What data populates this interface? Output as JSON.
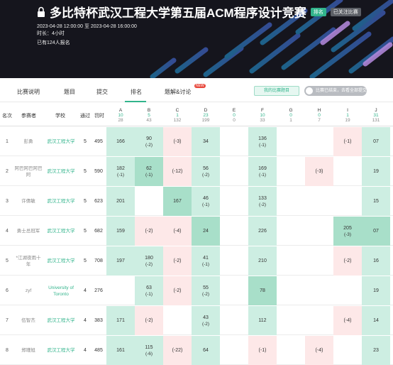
{
  "banner": {
    "title": "多比特杯武汉工程大学第五届ACM程序设计竞赛",
    "badge_status": "排名",
    "badge_follow": "已关注比赛",
    "time_range": "2023-04-28 12:00:00 至 2023-04-28 16:00:00",
    "duration": "时长：4小时",
    "signup": "已有124人报名"
  },
  "tabs": [
    {
      "label": "比赛说明"
    },
    {
      "label": "题目"
    },
    {
      "label": "提交"
    },
    {
      "label": "排名"
    },
    {
      "label": "题解&讨论"
    }
  ],
  "new_tag": "NEW",
  "my_problems_button": "我的比赛题目",
  "toggle_label": "比赛已结束，去看全部提交",
  "headers": {
    "rank": "名次",
    "user": "参赛者",
    "school": "学校",
    "solved": "通过",
    "penalty": "罚时"
  },
  "problems": [
    {
      "letter": "A",
      "ac": "10",
      "total": "28"
    },
    {
      "letter": "B",
      "ac": "5",
      "total": "43"
    },
    {
      "letter": "C",
      "ac": "1",
      "total": "132"
    },
    {
      "letter": "D",
      "ac": "23",
      "total": "199"
    },
    {
      "letter": "E",
      "ac": "0",
      "total": "0"
    },
    {
      "letter": "F",
      "ac": "10",
      "total": "33"
    },
    {
      "letter": "G",
      "ac": "0",
      "total": "1"
    },
    {
      "letter": "H",
      "ac": "0",
      "total": "7"
    },
    {
      "letter": "I",
      "ac": "1",
      "total": "19"
    },
    {
      "letter": "J",
      "ac": "31",
      "total": "131"
    }
  ],
  "rows": [
    {
      "rank": "1",
      "user": "彭勇",
      "school": "武汉工程大学",
      "solved": "5",
      "penalty": "495",
      "cells": [
        [
          "166",
          "",
          "ac"
        ],
        [
          "90",
          "(-2)",
          "ac"
        ],
        [
          "(-3)",
          "",
          "wa"
        ],
        [
          "34",
          "",
          "ac"
        ],
        [
          "",
          "",
          ""
        ],
        [
          "136",
          "(-1)",
          "ac"
        ],
        [
          "",
          "",
          ""
        ],
        [
          "",
          "",
          ""
        ],
        [
          "(-1)",
          "",
          "wa"
        ],
        [
          "07",
          "",
          "ac"
        ]
      ]
    },
    {
      "rank": "2",
      "user": "阿巴阿巴阿巴阿",
      "school": "武汉工程大学",
      "solved": "5",
      "penalty": "590",
      "cells": [
        [
          "182",
          "(-1)",
          "ac"
        ],
        [
          "62",
          "(-1)",
          "first"
        ],
        [
          "(-12)",
          "",
          "wa"
        ],
        [
          "56",
          "(-2)",
          "ac"
        ],
        [
          "",
          "",
          ""
        ],
        [
          "169",
          "(-1)",
          "ac"
        ],
        [
          "",
          "",
          ""
        ],
        [
          "(-3)",
          "",
          "wa"
        ],
        [
          "",
          "",
          ""
        ],
        [
          "19",
          "",
          "ac"
        ]
      ]
    },
    {
      "rank": "3",
      "user": "许倩敏",
      "school": "武汉工程大学",
      "solved": "5",
      "penalty": "623",
      "cells": [
        [
          "201",
          "",
          "ac"
        ],
        [
          "",
          "",
          ""
        ],
        [
          "167",
          "",
          "first"
        ],
        [
          "46",
          "(-1)",
          "ac"
        ],
        [
          "",
          "",
          ""
        ],
        [
          "133",
          "(-2)",
          "ac"
        ],
        [
          "",
          "",
          ""
        ],
        [
          "",
          "",
          ""
        ],
        [
          "",
          "",
          ""
        ],
        [
          "15",
          "",
          "ac"
        ]
      ]
    },
    {
      "rank": "4",
      "user": "勇士总冠军",
      "school": "武汉工程大学",
      "solved": "5",
      "penalty": "682",
      "cells": [
        [
          "159",
          "",
          "ac"
        ],
        [
          "(-2)",
          "",
          "wa"
        ],
        [
          "(-4)",
          "",
          "wa"
        ],
        [
          "24",
          "",
          "first"
        ],
        [
          "",
          "",
          ""
        ],
        [
          "226",
          "",
          "ac"
        ],
        [
          "",
          "",
          ""
        ],
        [
          "",
          "",
          ""
        ],
        [
          "205",
          "(-3)",
          "first"
        ],
        [
          "07",
          "",
          "first"
        ]
      ]
    },
    {
      "rank": "5",
      "user": "*江湖夜雨十年",
      "school": "武汉工程大学",
      "solved": "5",
      "penalty": "708",
      "cells": [
        [
          "197",
          "",
          "ac"
        ],
        [
          "180",
          "(-2)",
          "ac"
        ],
        [
          "(-2)",
          "",
          "wa"
        ],
        [
          "41",
          "(-1)",
          "ac"
        ],
        [
          "",
          "",
          ""
        ],
        [
          "210",
          "",
          "ac"
        ],
        [
          "",
          "",
          ""
        ],
        [
          "",
          "",
          ""
        ],
        [
          "(-2)",
          "",
          "wa"
        ],
        [
          "16",
          "",
          "ac"
        ]
      ]
    },
    {
      "rank": "6",
      "user": "zyf",
      "school": "University of Toronto",
      "solved": "4",
      "penalty": "276",
      "cells": [
        [
          "",
          "",
          ""
        ],
        [
          "63",
          "(-1)",
          "ac"
        ],
        [
          "(-2)",
          "",
          "wa"
        ],
        [
          "55",
          "(-2)",
          "ac"
        ],
        [
          "",
          "",
          ""
        ],
        [
          "78",
          "",
          "first"
        ],
        [
          "",
          "",
          ""
        ],
        [
          "",
          "",
          ""
        ],
        [
          "",
          "",
          ""
        ],
        [
          "19",
          "",
          "ac"
        ]
      ]
    },
    {
      "rank": "7",
      "user": "伍智杰",
      "school": "武汉工程大学",
      "solved": "4",
      "penalty": "383",
      "cells": [
        [
          "171",
          "",
          "ac"
        ],
        [
          "(-2)",
          "",
          "wa"
        ],
        [
          "",
          "",
          ""
        ],
        [
          "43",
          "(-2)",
          "ac"
        ],
        [
          "",
          "",
          ""
        ],
        [
          "112",
          "",
          "ac"
        ],
        [
          "",
          "",
          ""
        ],
        [
          "",
          "",
          ""
        ],
        [
          "(-4)",
          "",
          "wa"
        ],
        [
          "14",
          "",
          "ac"
        ]
      ]
    },
    {
      "rank": "8",
      "user": "郑瑾旭",
      "school": "武汉工程大学",
      "solved": "4",
      "penalty": "485",
      "cells": [
        [
          "161",
          "",
          "ac"
        ],
        [
          "115",
          "(-6)",
          "ac"
        ],
        [
          "(-22)",
          "",
          "wa"
        ],
        [
          "64",
          "",
          "ac"
        ],
        [
          "",
          "",
          ""
        ],
        [
          "(-1)",
          "",
          "wa"
        ],
        [
          "",
          "",
          ""
        ],
        [
          "(-4)",
          "",
          "wa"
        ],
        [
          "",
          "",
          ""
        ],
        [
          "23",
          "",
          "ac"
        ]
      ]
    }
  ]
}
